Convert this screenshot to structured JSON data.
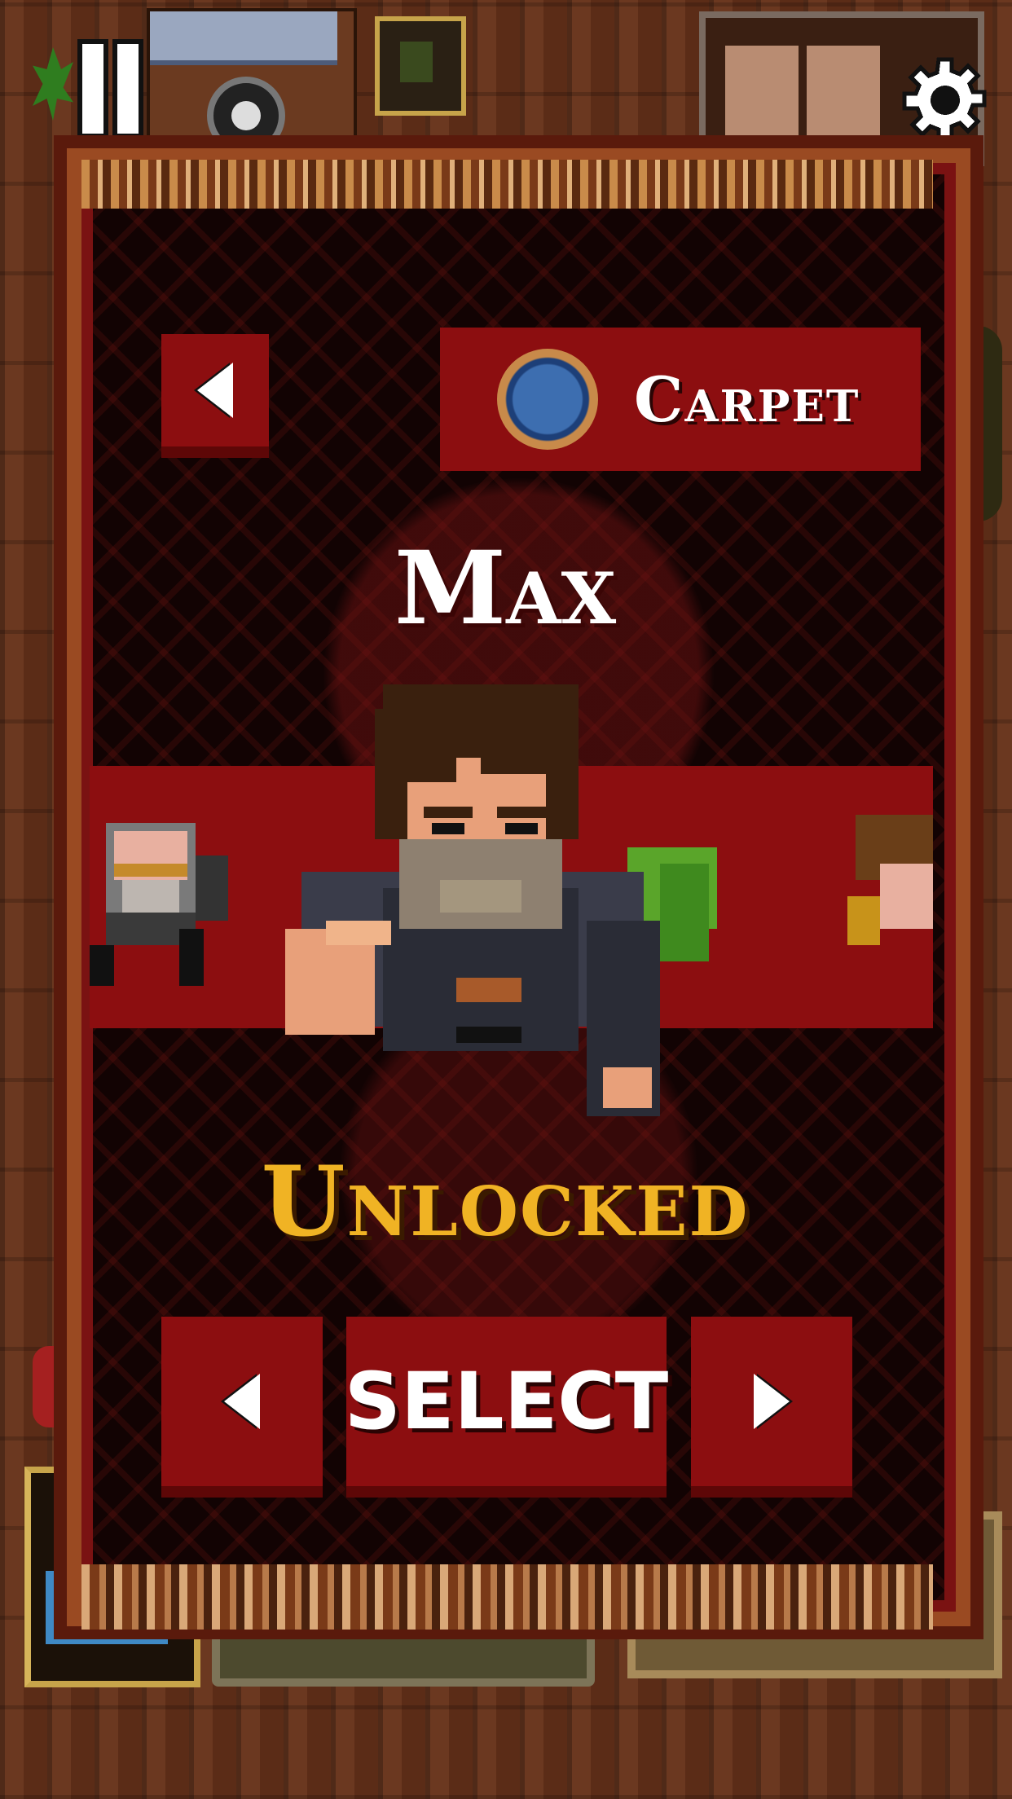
{
  "room": {
    "name": "Carpet",
    "badge_icon": "mandala-icon"
  },
  "character": {
    "name": "Max",
    "status": "Unlocked",
    "status_color": "#f0b324"
  },
  "buttons": {
    "select_label": "SELECT",
    "room_prev_icon": "left-arrow-icon",
    "char_prev_icon": "left-arrow-icon",
    "char_next_icon": "right-arrow-icon"
  },
  "hud": {
    "pause_icon": "pause-icon",
    "settings_icon": "gear-icon"
  },
  "colors": {
    "carpet_red": "#8c0e10",
    "carpet_dark": "#120303",
    "text": "#ffffff"
  }
}
